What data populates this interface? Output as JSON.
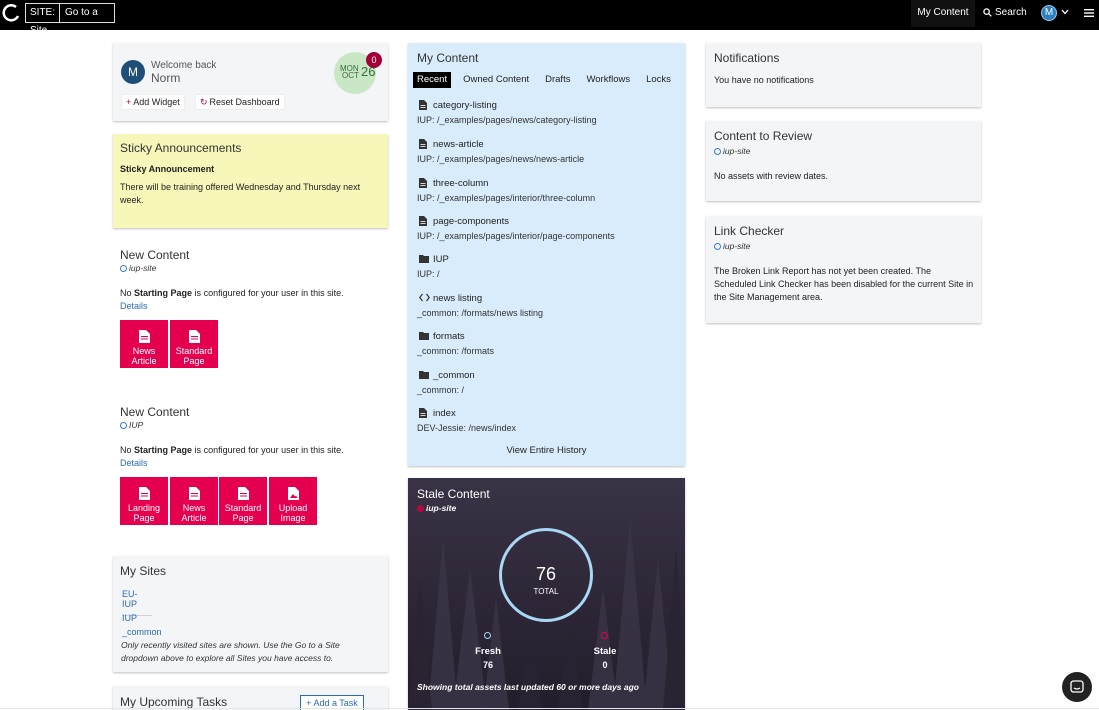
{
  "topbar": {
    "site_label": "SITE:",
    "site_value": "Go to a Site",
    "my_content": "My Content",
    "search": "Search",
    "user_initial": "M"
  },
  "welcome": {
    "greeting": "Welcome back",
    "name": "Norm",
    "avatar_initial": "M",
    "weekday": "MON",
    "month": "OCT",
    "day": "26",
    "badge_count": "0",
    "add_widget": "Add Widget",
    "reset_dashboard": "Reset Dashboard"
  },
  "sticky": {
    "title": "Sticky Announcements",
    "item_title": "Sticky Announcement",
    "item_body": "There will be training offered Wednesday and Thursday next week."
  },
  "new_content_1": {
    "title": "New Content",
    "site": "iup-site",
    "msg_prefix": "No",
    "msg_bold": "Starting Page",
    "msg_suffix": "is configured for your user in this site.",
    "details": "Details",
    "tiles": [
      "News Article",
      "Standard Page"
    ]
  },
  "new_content_2": {
    "title": "New Content",
    "site": "IUP",
    "msg_prefix": "No",
    "msg_bold": "Starting Page",
    "msg_suffix": "is configured for your user in this site.",
    "details": "Details",
    "tiles": [
      "Landing Page",
      "News Article",
      "Standard Page",
      "Upload Image"
    ]
  },
  "my_sites": {
    "title": "My Sites",
    "sites": [
      "EU-IUP",
      "IUP",
      "_common"
    ],
    "note": "Only recently visited sites are shown. Use the Go to a Site dropdown above to explore all Sites you have access to."
  },
  "tasks": {
    "title": "My Upcoming Tasks",
    "add": "Add a Task"
  },
  "my_content": {
    "title": "My Content",
    "tabs": [
      "Recent",
      "Owned Content",
      "Drafts",
      "Workflows",
      "Locks"
    ],
    "items": [
      {
        "name": "category-listing",
        "path": "IUP: /_examples/pages/news/category-listing",
        "icon": "file"
      },
      {
        "name": "news-article",
        "path": "IUP: /_examples/pages/news/news-article",
        "icon": "file"
      },
      {
        "name": "three-column",
        "path": "IUP: /_examples/pages/interior/three-column",
        "icon": "file"
      },
      {
        "name": "page-components",
        "path": "IUP: /_examples/pages/interior/page-components",
        "icon": "file"
      },
      {
        "name": "IUP",
        "path": "IUP: /",
        "icon": "folder"
      },
      {
        "name": "news listing",
        "path": "_common: /formats/news listing",
        "icon": "code"
      },
      {
        "name": "formats",
        "path": "_common: /formats",
        "icon": "folder"
      },
      {
        "name": "_common",
        "path": "_common: /",
        "icon": "folder"
      },
      {
        "name": "index",
        "path": "DEV-Jessie: /news/index",
        "icon": "file"
      }
    ],
    "history": "View Entire History"
  },
  "stale": {
    "title": "Stale Content",
    "site": "iup-site",
    "total": "76",
    "total_label": "TOTAL",
    "fresh_label": "Fresh",
    "fresh_value": "76",
    "stale_label": "Stale",
    "stale_value": "0",
    "footer": "Showing total assets last updated 60 or more days ago"
  },
  "notifications": {
    "title": "Notifications",
    "message": "You have no notifications"
  },
  "review": {
    "title": "Content to Review",
    "site": "iup-site",
    "message": "No assets with review dates."
  },
  "link_checker": {
    "title": "Link Checker",
    "site": "iup-site",
    "message": "The Broken Link Report has not yet been created. The Scheduled Link Checker has been disabled for the current Site in the Site Management area."
  }
}
